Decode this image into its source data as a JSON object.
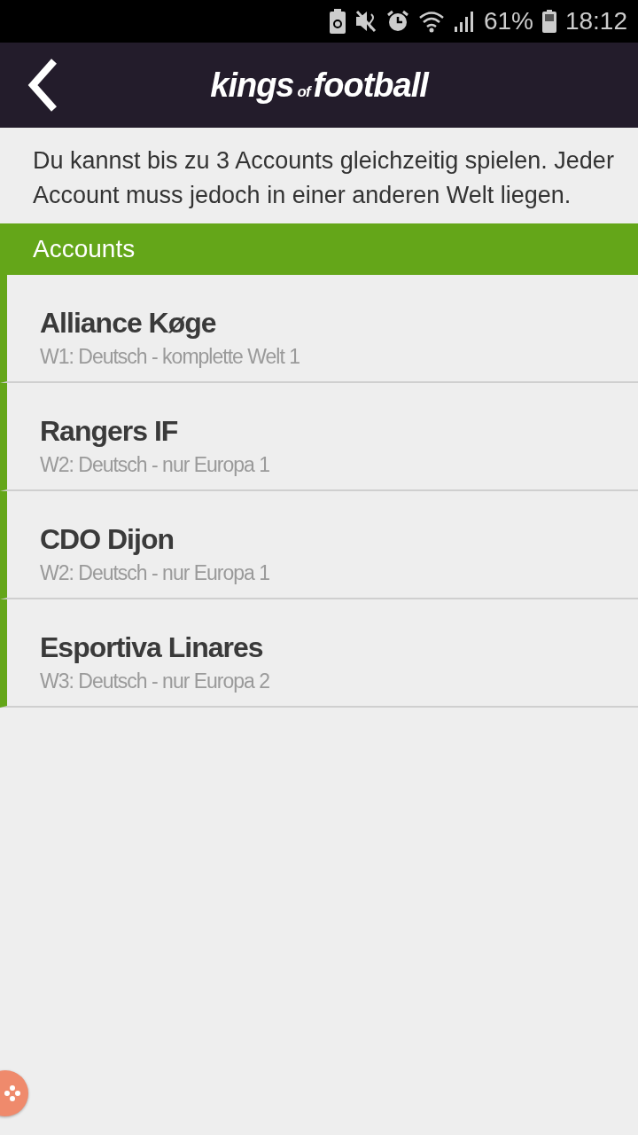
{
  "status_bar": {
    "battery_percent": "61%",
    "time": "18:12"
  },
  "header": {
    "logo": {
      "first": "kings",
      "middle": "of",
      "last": "football"
    }
  },
  "intro": "Du kannst bis zu 3 Accounts gleichzeitig spielen. Jeder Account muss jedoch in einer anderen Welt liegen.",
  "section_title": "Accounts",
  "accounts": [
    {
      "name": "Alliance Køge",
      "world": "W1: Deutsch - komplette Welt 1"
    },
    {
      "name": "Rangers IF",
      "world": "W2: Deutsch - nur Europa 1"
    },
    {
      "name": "CDO Dijon",
      "world": "W2: Deutsch - nur Europa 1"
    },
    {
      "name": "Esportiva Linares",
      "world": "W3: Deutsch - nur Europa 2"
    }
  ]
}
